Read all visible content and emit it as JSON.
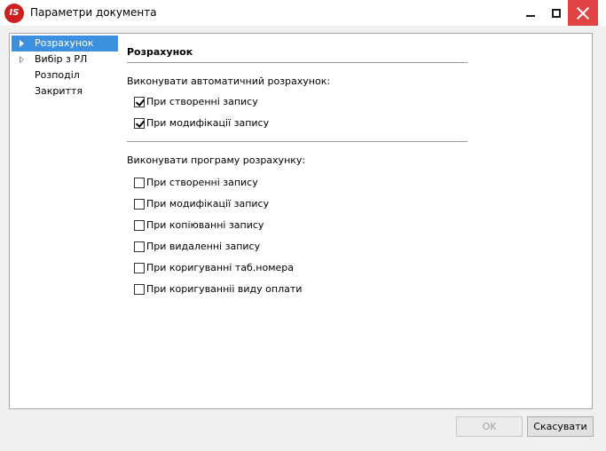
{
  "window": {
    "logo_text": "IS",
    "title": "Параметри документа"
  },
  "tree": {
    "items": [
      {
        "label": "Розрахунок",
        "selected": true,
        "expandable": true
      },
      {
        "label": "Вибір з РЛ",
        "selected": false,
        "expandable": true
      },
      {
        "label": "Розподіл",
        "selected": false,
        "expandable": false
      },
      {
        "label": "Закриття",
        "selected": false,
        "expandable": false
      }
    ]
  },
  "section": {
    "heading": "Розрахунок",
    "auto_calc": {
      "label": "Виконувати автоматичний розрахунок:",
      "options": [
        {
          "label": "При створенні запису",
          "checked": true
        },
        {
          "label": "При модифікації запису",
          "checked": true
        }
      ]
    },
    "program_calc": {
      "label": "Виконувати програму розрахунку:",
      "options": [
        {
          "label": "При створенні запису",
          "checked": false
        },
        {
          "label": "При модифікації запису",
          "checked": false
        },
        {
          "label": "При копіюванні запису",
          "checked": false
        },
        {
          "label": "При видаленні запису",
          "checked": false
        },
        {
          "label": "При коригуванні таб.номера",
          "checked": false
        },
        {
          "label": "При коригуванніі виду оплати",
          "checked": false
        }
      ]
    }
  },
  "buttons": {
    "ok": "OK",
    "cancel": "Скасувати"
  },
  "colors": {
    "selection": "#3d8fe0",
    "close_button": "#e04343",
    "logo": "#cc1f1f"
  }
}
